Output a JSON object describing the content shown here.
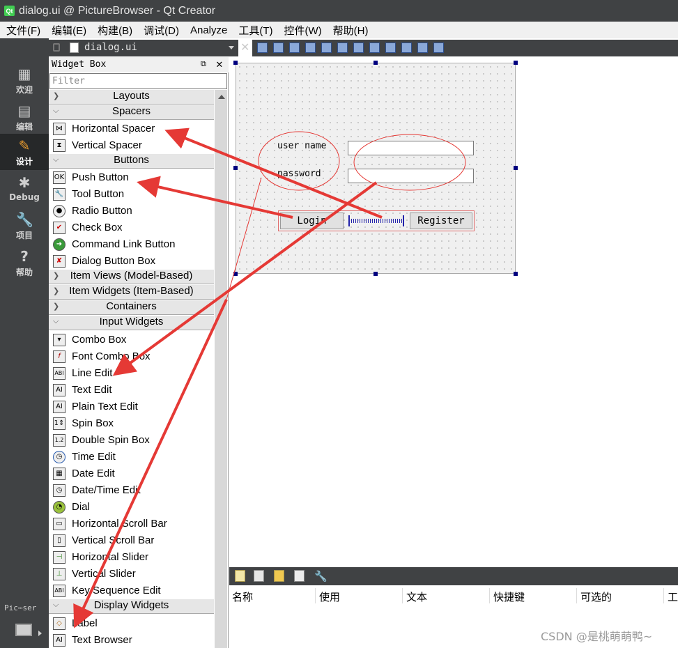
{
  "window": {
    "title": "dialog.ui @ PictureBrowser - Qt Creator",
    "app_icon": "Qt"
  },
  "menu": [
    "文件(F)",
    "编辑(E)",
    "构建(B)",
    "调试(D)",
    "Analyze",
    "工具(T)",
    "控件(W)",
    "帮助(H)"
  ],
  "modes": [
    "欢迎",
    "编辑",
    "设计",
    "Debug",
    "项目",
    "帮助"
  ],
  "kit_label": "Pic⋯ser",
  "editor": {
    "filename": "dialog.ui"
  },
  "widget_box": {
    "title": "Widget Box",
    "filter_placeholder": "Filter",
    "categories": {
      "layouts": "Layouts",
      "spacers": "Spacers",
      "buttons": "Buttons",
      "item_views": "Item Views (Model-Based)",
      "item_widgets": "Item Widgets (Item-Based)",
      "containers": "Containers",
      "input_widgets": "Input Widgets",
      "display_widgets": "Display Widgets"
    },
    "spacers": [
      "Horizontal Spacer",
      "Vertical Spacer"
    ],
    "buttons": [
      "Push Button",
      "Tool Button",
      "Radio Button",
      "Check Box",
      "Command Link Button",
      "Dialog Button Box"
    ],
    "input_widgets": [
      "Combo Box",
      "Font Combo Box",
      "Line Edit",
      "Text Edit",
      "Plain Text Edit",
      "Spin Box",
      "Double Spin Box",
      "Time Edit",
      "Date Edit",
      "Date/Time Edit",
      "Dial",
      "Horizontal Scroll Bar",
      "Vertical Scroll Bar",
      "Horizontal Slider",
      "Vertical Slider",
      "Key Sequence Edit"
    ],
    "display_widgets": [
      "Label",
      "Text Browser"
    ]
  },
  "form": {
    "username_label": "user name",
    "password_label": "password",
    "login_button": "Login",
    "register_button": "Register"
  },
  "action_editor": {
    "columns": [
      "名称",
      "使用",
      "文本",
      "快捷键",
      "可选的",
      "工"
    ]
  },
  "watermark": "CSDN @是桃萌萌鸭~",
  "colors": {
    "annotation": "#e53935",
    "dark_chrome": "#404244",
    "handle": "#00007f"
  }
}
